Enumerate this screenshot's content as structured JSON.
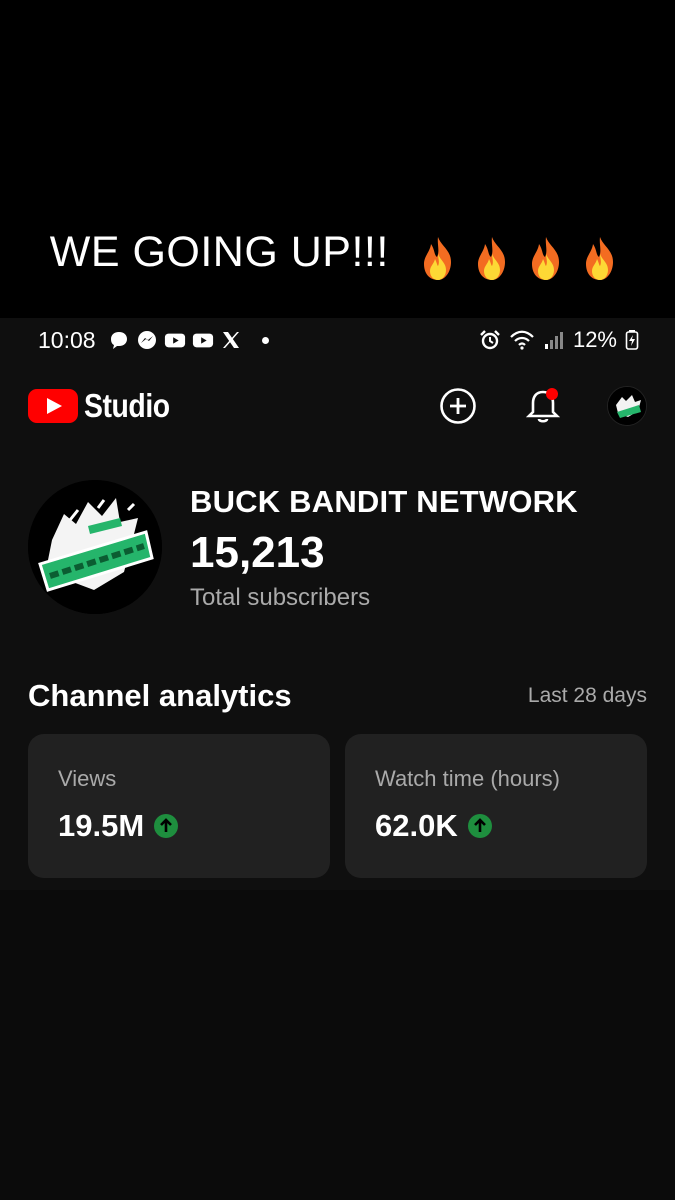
{
  "caption": {
    "text": "WE GOING UP!!!",
    "emoji_icon": "fire-emoji-x4"
  },
  "status_bar": {
    "time": "10:08",
    "notification_icons": [
      "chat-bubble-icon",
      "messenger-icon",
      "youtube-icon",
      "youtube-icon",
      "x-icon"
    ],
    "right_icons": [
      "alarm-icon",
      "wifi-icon",
      "signal-icon"
    ],
    "battery": "12%"
  },
  "header": {
    "logo_text": "Studio",
    "brand_color": "#ff0000",
    "notification_dot_color": "#ff0000"
  },
  "channel": {
    "name": "BUCK BANDIT NETWORK",
    "subscribers": "15,213",
    "subscribers_label": "Total subscribers",
    "avatar_accent": "#25b56b"
  },
  "analytics": {
    "title": "Channel analytics",
    "period": "Last 28 days",
    "cards": [
      {
        "label": "Views",
        "value": "19.5M",
        "trend": "up"
      },
      {
        "label": "Watch time (hours)",
        "value": "62.0K",
        "trend": "up"
      }
    ],
    "trend_color": "#1e8e3e"
  }
}
